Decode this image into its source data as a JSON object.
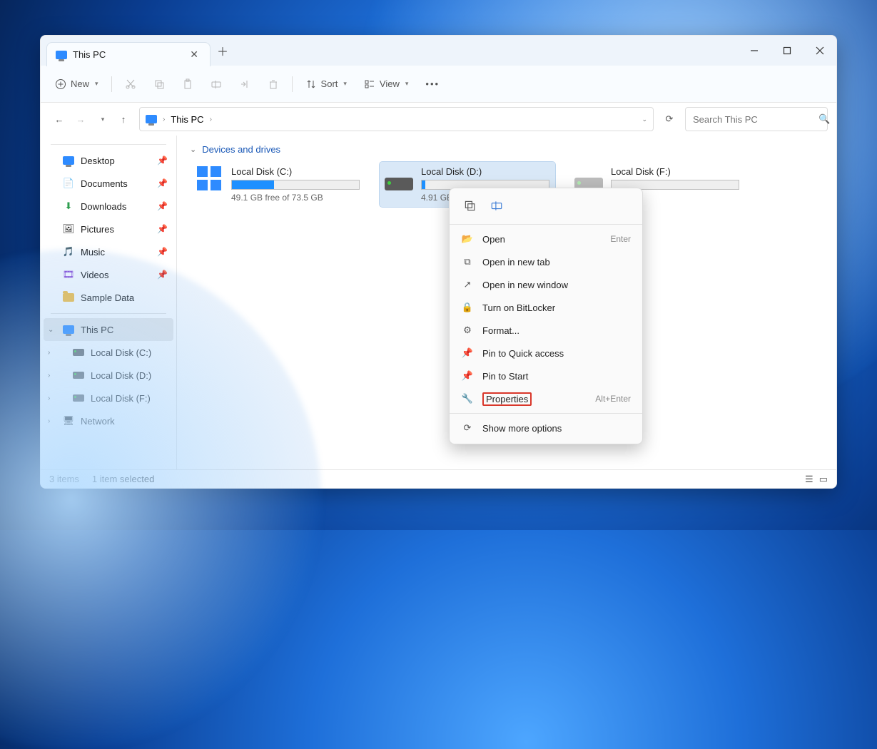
{
  "tab": {
    "title": "This PC"
  },
  "toolbar": {
    "new": "New",
    "sort": "Sort",
    "view": "View"
  },
  "address": {
    "crumb": "This PC"
  },
  "search": {
    "placeholder": "Search This PC"
  },
  "sidebar": {
    "quick": [
      {
        "label": "Desktop"
      },
      {
        "label": "Documents"
      },
      {
        "label": "Downloads"
      },
      {
        "label": "Pictures"
      },
      {
        "label": "Music"
      },
      {
        "label": "Videos"
      },
      {
        "label": "Sample Data"
      }
    ],
    "thispc": "This PC",
    "drives": [
      {
        "label": "Local Disk (C:)"
      },
      {
        "label": "Local Disk (D:)"
      },
      {
        "label": "Local Disk (F:)"
      }
    ],
    "network": "Network"
  },
  "group_header": "Devices and drives",
  "drives": [
    {
      "name": "Local Disk (C:)",
      "free_text": "49.1 GB free of 73.5 GB",
      "fill_pct": 33
    },
    {
      "name": "Local Disk (D:)",
      "free_text": "4.91 GB free of 4.9",
      "fill_pct": 3
    },
    {
      "name": "Local Disk (F:)",
      "free_text": "",
      "fill_pct": 0
    }
  ],
  "context_menu": {
    "open": "Open",
    "open_shortcut": "Enter",
    "open_tab": "Open in new tab",
    "open_window": "Open in new window",
    "bitlocker": "Turn on BitLocker",
    "format": "Format...",
    "pin_quick": "Pin to Quick access",
    "pin_start": "Pin to Start",
    "properties": "Properties",
    "properties_shortcut": "Alt+Enter",
    "more": "Show more options"
  },
  "status": {
    "items": "3 items",
    "selected": "1 item selected"
  }
}
